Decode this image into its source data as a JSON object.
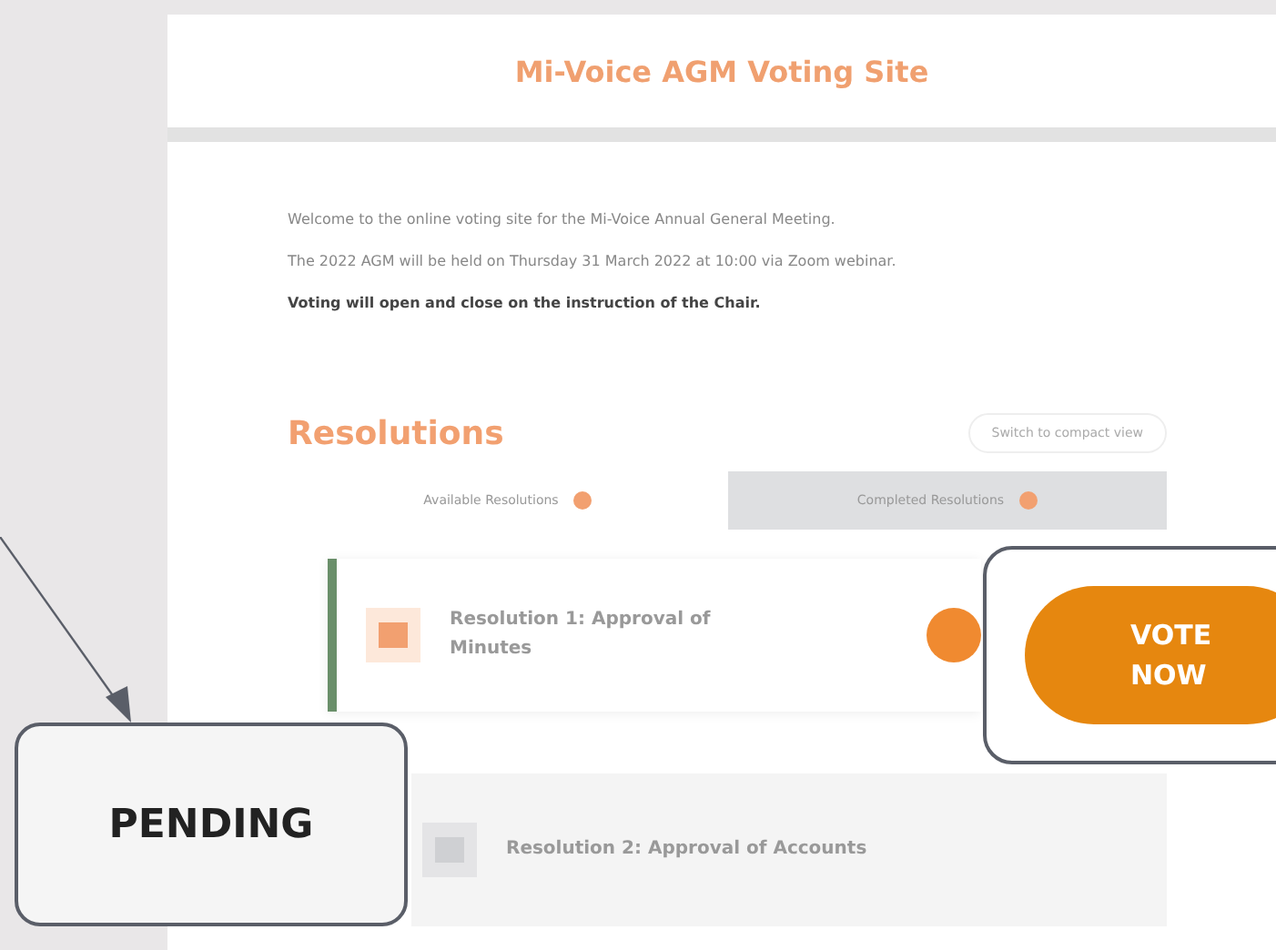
{
  "site": {
    "title": "Mi-Voice AGM Voting Site"
  },
  "intro": [
    "Welcome to the online voting site for the Mi-Voice Annual General Meeting.",
    "The 2022 AGM will be held on Thursday 31 March 2022 at 10:00 via Zoom webinar.",
    "Voting will open and close on the instruction of the Chair."
  ],
  "resolutions": {
    "heading": "Resolutions",
    "switch_button": "Switch to compact view",
    "tabs": [
      {
        "label": "Available Resolutions",
        "selected": true
      },
      {
        "label": "Completed Resolutions",
        "selected": false
      }
    ],
    "items": [
      {
        "title": "Resolution 1: Approval of Minutes",
        "kind": "open"
      },
      {
        "title": "Resolution 2: Approval of Accounts",
        "kind": "closed"
      }
    ]
  },
  "callouts": {
    "status": "PENDING",
    "action": "VOTE NOW"
  }
}
